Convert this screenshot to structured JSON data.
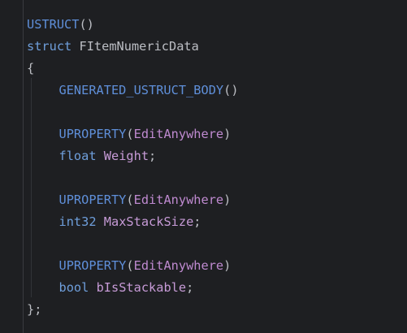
{
  "colors": {
    "background": "#1e1f22",
    "keyword": "#6f9fdc",
    "macro": "#5f8fd9",
    "specifier": "#bf8ad0",
    "field": "#c79bd7",
    "text": "#bcbec4"
  },
  "code": {
    "ustruct_macro": "USTRUCT",
    "ustruct_parens": "()",
    "struct_keyword": "struct",
    "struct_name": "FItemNumericData",
    "open_brace": "{",
    "generated_body_macro": "GENERATED_USTRUCT_BODY",
    "generated_body_parens": "()",
    "uproperty_macro": "UPROPERTY",
    "uproperty_open": "(",
    "uproperty_specifier": "EditAnywhere",
    "uproperty_close": ")",
    "fields": [
      {
        "type": "float",
        "name": "Weight",
        "terminator": ";"
      },
      {
        "type": "int32",
        "name": "MaxStackSize",
        "terminator": ";"
      },
      {
        "type": "bool",
        "name": "bIsStackable",
        "terminator": ";"
      }
    ],
    "close_brace": "};"
  }
}
